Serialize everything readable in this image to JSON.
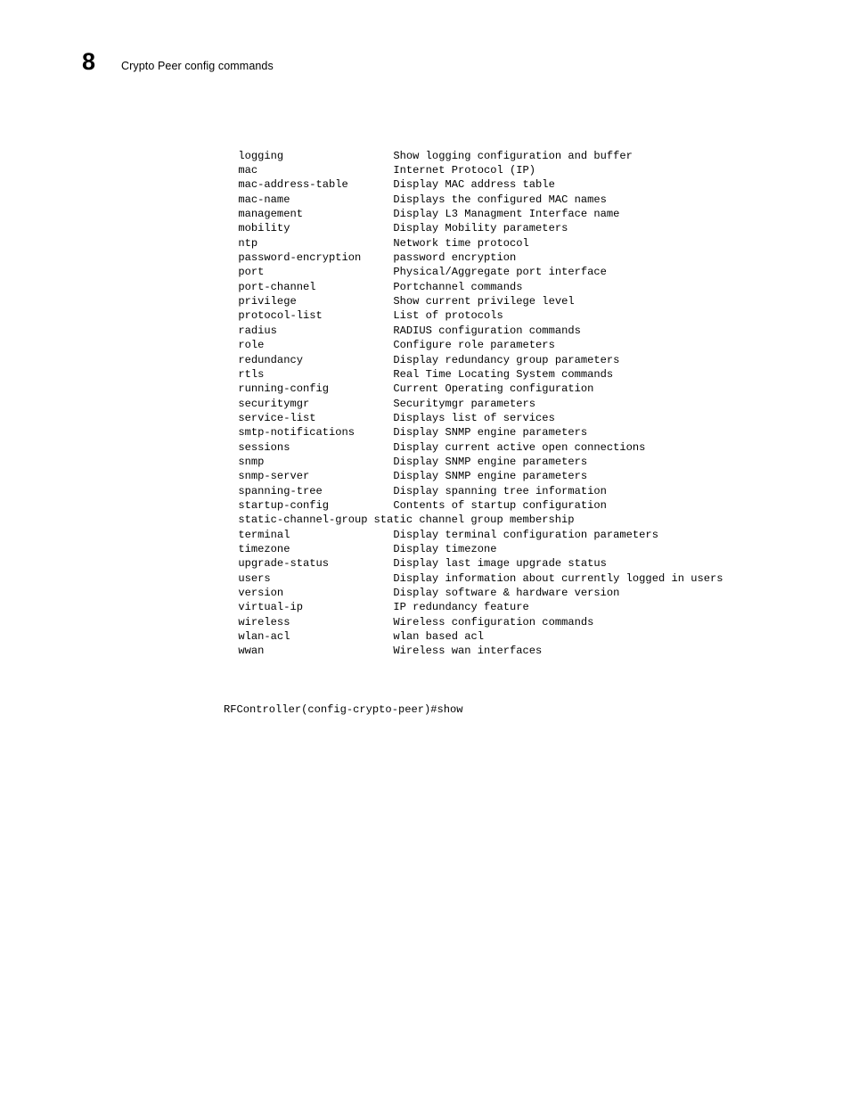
{
  "header": {
    "chapter_number": "8",
    "title": "Crypto Peer config commands"
  },
  "console": {
    "commands": [
      {
        "name": "logging",
        "description": "Show logging configuration and buffer"
      },
      {
        "name": "mac",
        "description": "Internet Protocol (IP)"
      },
      {
        "name": "mac-address-table",
        "description": "Display MAC address table"
      },
      {
        "name": "mac-name",
        "description": "Displays the configured MAC names"
      },
      {
        "name": "management",
        "description": "Display L3 Managment Interface name"
      },
      {
        "name": "mobility",
        "description": "Display Mobility parameters"
      },
      {
        "name": "ntp",
        "description": "Network time protocol"
      },
      {
        "name": "password-encryption",
        "description": "password encryption"
      },
      {
        "name": "port",
        "description": "Physical/Aggregate port interface"
      },
      {
        "name": "port-channel",
        "description": "Portchannel commands"
      },
      {
        "name": "privilege",
        "description": "Show current privilege level"
      },
      {
        "name": "protocol-list",
        "description": "List of protocols"
      },
      {
        "name": "radius",
        "description": "RADIUS configuration commands"
      },
      {
        "name": "role",
        "description": "Configure role parameters"
      },
      {
        "name": "redundancy",
        "description": "Display redundancy group parameters"
      },
      {
        "name": "rtls",
        "description": "Real Time Locating System commands"
      },
      {
        "name": "running-config",
        "description": "Current Operating configuration"
      },
      {
        "name": "securitymgr",
        "description": "Securitymgr parameters"
      },
      {
        "name": "service-list",
        "description": "Displays list of services"
      },
      {
        "name": "smtp-notifications",
        "description": "Display SNMP engine parameters"
      },
      {
        "name": "sessions",
        "description": "Display current active open connections"
      },
      {
        "name": "snmp",
        "description": "Display SNMP engine parameters"
      },
      {
        "name": "snmp-server",
        "description": "Display SNMP engine parameters"
      },
      {
        "name": "spanning-tree",
        "description": "Display spanning tree information"
      },
      {
        "name": "startup-config",
        "description": "Contents of startup configuration"
      },
      {
        "name": "static-channel-group",
        "description": "static channel group membership"
      },
      {
        "name": "terminal",
        "description": "Display terminal configuration parameters"
      },
      {
        "name": "timezone",
        "description": "Display timezone"
      },
      {
        "name": "upgrade-status",
        "description": "Display last image upgrade status"
      },
      {
        "name": "users",
        "description": "Display information about currently logged in users"
      },
      {
        "name": "version",
        "description": "Display software & hardware version"
      },
      {
        "name": "virtual-ip",
        "description": "IP redundancy feature"
      },
      {
        "name": "wireless",
        "description": "Wireless configuration commands"
      },
      {
        "name": "wlan-acl",
        "description": "wlan based acl"
      },
      {
        "name": "wwan",
        "description": "Wireless wan interfaces"
      }
    ],
    "prompt_line": "RFController(config-crypto-peer)#show"
  }
}
